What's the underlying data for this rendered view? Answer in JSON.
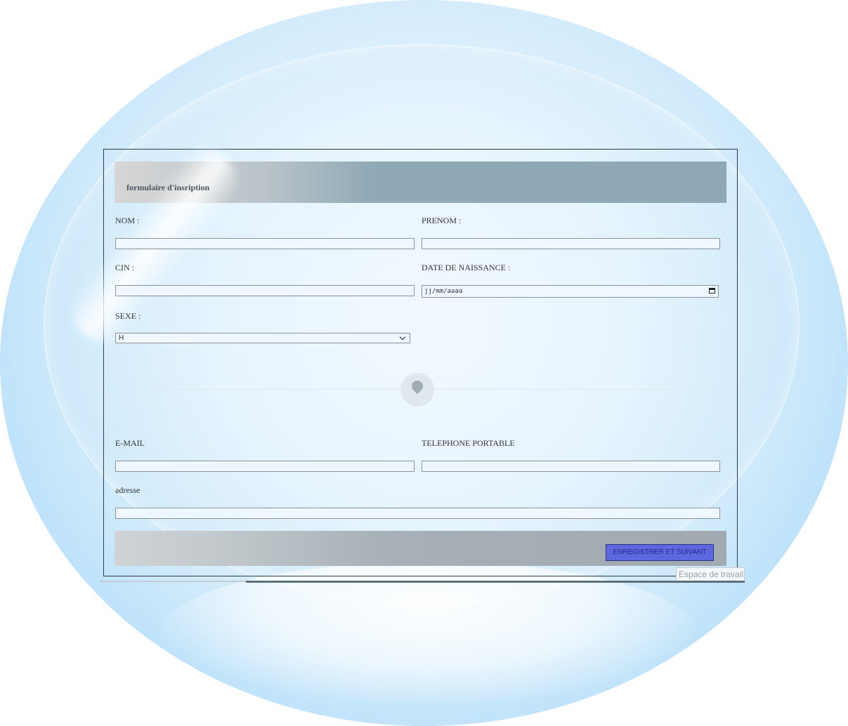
{
  "form": {
    "title": "formulaire d'insription",
    "fields": {
      "nom_label": "NOM :",
      "prenom_label": "PRENOM :",
      "cin_label": "CIN :",
      "date_label": "DATE DE NAISSANCE :",
      "date_placeholder": "jj/mm/aaaa",
      "sexe_label": "SEXE :",
      "sexe_value": "H",
      "email_label": "E-MAIL",
      "telephone_label": "TELEPHONE PORTABLE",
      "adresse_label": "adresse"
    },
    "submit_label": "ENREGISTRER ET SUIVANT",
    "divider_icon": "location-pin-icon"
  },
  "tooltip": {
    "text": "Espace de travail \\"
  },
  "colors": {
    "button_bg": "#5d68e0",
    "header_bar": "#8ea8b5",
    "footer_bar": "#a1aab0"
  }
}
